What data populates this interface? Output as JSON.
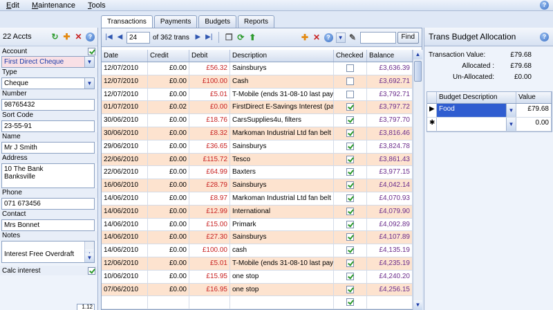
{
  "menu": [
    {
      "label": "Edit",
      "u": "E",
      "rest": "dit"
    },
    {
      "label": "Maintenance",
      "u": "M",
      "rest": "aintenance"
    },
    {
      "label": "Tools",
      "u": "T",
      "rest": "ools"
    }
  ],
  "tabs": [
    "Transactions",
    "Payments",
    "Budgets",
    "Reports"
  ],
  "left": {
    "count": "22 Accts",
    "account_label": "Account",
    "account_value": "First Direct Cheque",
    "type_label": "Type",
    "type_value": "Cheque",
    "number_label": "Number",
    "number_value": "98765432",
    "sort_label": "Sort Code",
    "sort_value": "23-55-91",
    "name_label": "Name",
    "name_value": "Mr J Smith",
    "address_label": "Address",
    "address_value": "10 The Bank\nBanksville",
    "phone_label": "Phone",
    "phone_value": "071 673456",
    "contact_label": "Contact",
    "contact_value": "Mrs Bonnet",
    "notes_label": "Notes",
    "notes_value": "Interest Free Overdraft",
    "calc_label": "Calc interest",
    "calc_extra": "1.12"
  },
  "nav": {
    "position": "24",
    "of_text": "of 362 trans",
    "find_label": "Find"
  },
  "grid": {
    "headers": [
      "Date",
      "Credit",
      "Debit",
      "Description",
      "Checked",
      "Balance"
    ],
    "rows": [
      {
        "date": "12/07/2010",
        "credit": "£0.00",
        "debit": "£56.32",
        "desc": "Sainsburys",
        "checked": false,
        "bal": "£3,636.39"
      },
      {
        "date": "12/07/2010",
        "credit": "£0.00",
        "debit": "£100.00",
        "desc": "Cash",
        "checked": false,
        "bal": "£3,692.71"
      },
      {
        "date": "12/07/2010",
        "credit": "£0.00",
        "debit": "£5.01",
        "desc": "T-Mobile  (ends 31-08-10 last pay...",
        "checked": false,
        "bal": "£3,792.71"
      },
      {
        "date": "01/07/2010",
        "credit": "£0.02",
        "debit": "£0.00",
        "desc": "FirstDirect E-Savings Interest (pay...",
        "checked": true,
        "bal": "£3,797.72"
      },
      {
        "date": "30/06/2010",
        "credit": "£0.00",
        "debit": "£18.76",
        "desc": "CarsSupplies4u, filters",
        "checked": true,
        "bal": "£3,797.70"
      },
      {
        "date": "30/06/2010",
        "credit": "£0.00",
        "debit": "£8.32",
        "desc": "Markoman Industrial Ltd fan belt",
        "checked": true,
        "bal": "£3,816.46"
      },
      {
        "date": "29/06/2010",
        "credit": "£0.00",
        "debit": "£36.65",
        "desc": "Sainsburys",
        "checked": true,
        "bal": "£3,824.78"
      },
      {
        "date": "22/06/2010",
        "credit": "£0.00",
        "debit": "£115.72",
        "desc": "Tesco",
        "checked": true,
        "bal": "£3,861.43"
      },
      {
        "date": "22/06/2010",
        "credit": "£0.00",
        "debit": "£64.99",
        "desc": "Baxters",
        "checked": true,
        "bal": "£3,977.15"
      },
      {
        "date": "16/06/2010",
        "credit": "£0.00",
        "debit": "£28.79",
        "desc": "Sainsburys",
        "checked": true,
        "bal": "£4,042.14"
      },
      {
        "date": "14/06/2010",
        "credit": "£0.00",
        "debit": "£8.97",
        "desc": "Markoman Industrial Ltd fan belt",
        "checked": true,
        "bal": "£4,070.93"
      },
      {
        "date": "14/06/2010",
        "credit": "£0.00",
        "debit": "£12.99",
        "desc": "International",
        "checked": true,
        "bal": "£4,079.90"
      },
      {
        "date": "14/06/2010",
        "credit": "£0.00",
        "debit": "£15.00",
        "desc": "Primark",
        "checked": true,
        "bal": "£4,092.89"
      },
      {
        "date": "14/06/2010",
        "credit": "£0.00",
        "debit": "£27.30",
        "desc": "Sainsburys",
        "checked": true,
        "bal": "£4,107.89"
      },
      {
        "date": "14/06/2010",
        "credit": "£0.00",
        "debit": "£100.00",
        "desc": "cash",
        "checked": true,
        "bal": "£4,135.19"
      },
      {
        "date": "12/06/2010",
        "credit": "£0.00",
        "debit": "£5.01",
        "desc": "T-Mobile  (ends 31-08-10 last pay...",
        "checked": true,
        "bal": "£4,235.19"
      },
      {
        "date": "10/06/2010",
        "credit": "£0.00",
        "debit": "£15.95",
        "desc": "one stop",
        "checked": true,
        "bal": "£4,240.20"
      },
      {
        "date": "07/06/2010",
        "credit": "£0.00",
        "debit": "£16.95",
        "desc": "one stop",
        "checked": true,
        "bal": "£4,256.15"
      },
      {
        "date": "",
        "credit": "",
        "debit": "",
        "desc": "",
        "checked": true,
        "bal": ""
      }
    ]
  },
  "budget": {
    "title": "Trans Budget Allocation",
    "tv_label": "Transaction Value:",
    "tv_value": "£79.68",
    "alloc_label": "Allocated :",
    "alloc_value": "£79.68",
    "unalloc_label": "Un-Allocated:",
    "unalloc_value": "£0.00",
    "headers": [
      "Budget Description",
      "Value"
    ],
    "rows": [
      {
        "ind": "▶",
        "desc": "Food",
        "value": "£79.68",
        "selected": true
      },
      {
        "ind": "✱",
        "desc": "",
        "value": "0.00",
        "selected": false
      }
    ]
  },
  "colors": {
    "accent": "#2f5dd0",
    "alt_row": "#fde3cf",
    "debit": "#c82222",
    "balance": "#6b2d8c"
  }
}
